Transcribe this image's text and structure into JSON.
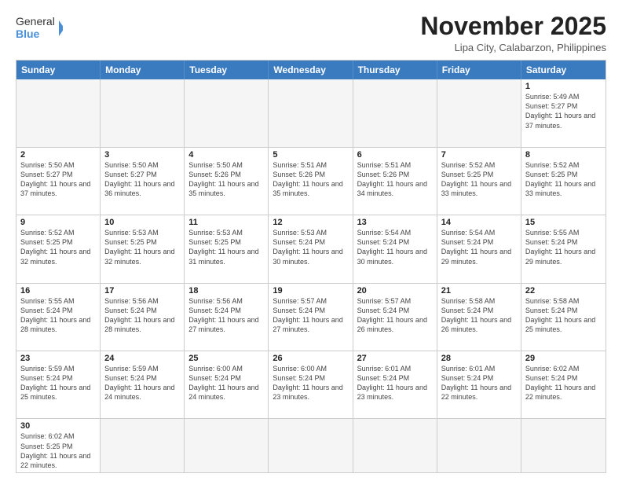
{
  "logo": {
    "text_general": "General",
    "text_blue": "Blue"
  },
  "title": "November 2025",
  "location": "Lipa City, Calabarzon, Philippines",
  "weekdays": [
    "Sunday",
    "Monday",
    "Tuesday",
    "Wednesday",
    "Thursday",
    "Friday",
    "Saturday"
  ],
  "rows": [
    [
      {
        "day": "",
        "info": ""
      },
      {
        "day": "",
        "info": ""
      },
      {
        "day": "",
        "info": ""
      },
      {
        "day": "",
        "info": ""
      },
      {
        "day": "",
        "info": ""
      },
      {
        "day": "",
        "info": ""
      },
      {
        "day": "1",
        "info": "Sunrise: 5:49 AM\nSunset: 5:27 PM\nDaylight: 11 hours and 37 minutes."
      }
    ],
    [
      {
        "day": "2",
        "info": "Sunrise: 5:50 AM\nSunset: 5:27 PM\nDaylight: 11 hours and 37 minutes."
      },
      {
        "day": "3",
        "info": "Sunrise: 5:50 AM\nSunset: 5:27 PM\nDaylight: 11 hours and 36 minutes."
      },
      {
        "day": "4",
        "info": "Sunrise: 5:50 AM\nSunset: 5:26 PM\nDaylight: 11 hours and 35 minutes."
      },
      {
        "day": "5",
        "info": "Sunrise: 5:51 AM\nSunset: 5:26 PM\nDaylight: 11 hours and 35 minutes."
      },
      {
        "day": "6",
        "info": "Sunrise: 5:51 AM\nSunset: 5:26 PM\nDaylight: 11 hours and 34 minutes."
      },
      {
        "day": "7",
        "info": "Sunrise: 5:52 AM\nSunset: 5:25 PM\nDaylight: 11 hours and 33 minutes."
      },
      {
        "day": "8",
        "info": "Sunrise: 5:52 AM\nSunset: 5:25 PM\nDaylight: 11 hours and 33 minutes."
      }
    ],
    [
      {
        "day": "9",
        "info": "Sunrise: 5:52 AM\nSunset: 5:25 PM\nDaylight: 11 hours and 32 minutes."
      },
      {
        "day": "10",
        "info": "Sunrise: 5:53 AM\nSunset: 5:25 PM\nDaylight: 11 hours and 32 minutes."
      },
      {
        "day": "11",
        "info": "Sunrise: 5:53 AM\nSunset: 5:25 PM\nDaylight: 11 hours and 31 minutes."
      },
      {
        "day": "12",
        "info": "Sunrise: 5:53 AM\nSunset: 5:24 PM\nDaylight: 11 hours and 30 minutes."
      },
      {
        "day": "13",
        "info": "Sunrise: 5:54 AM\nSunset: 5:24 PM\nDaylight: 11 hours and 30 minutes."
      },
      {
        "day": "14",
        "info": "Sunrise: 5:54 AM\nSunset: 5:24 PM\nDaylight: 11 hours and 29 minutes."
      },
      {
        "day": "15",
        "info": "Sunrise: 5:55 AM\nSunset: 5:24 PM\nDaylight: 11 hours and 29 minutes."
      }
    ],
    [
      {
        "day": "16",
        "info": "Sunrise: 5:55 AM\nSunset: 5:24 PM\nDaylight: 11 hours and 28 minutes."
      },
      {
        "day": "17",
        "info": "Sunrise: 5:56 AM\nSunset: 5:24 PM\nDaylight: 11 hours and 28 minutes."
      },
      {
        "day": "18",
        "info": "Sunrise: 5:56 AM\nSunset: 5:24 PM\nDaylight: 11 hours and 27 minutes."
      },
      {
        "day": "19",
        "info": "Sunrise: 5:57 AM\nSunset: 5:24 PM\nDaylight: 11 hours and 27 minutes."
      },
      {
        "day": "20",
        "info": "Sunrise: 5:57 AM\nSunset: 5:24 PM\nDaylight: 11 hours and 26 minutes."
      },
      {
        "day": "21",
        "info": "Sunrise: 5:58 AM\nSunset: 5:24 PM\nDaylight: 11 hours and 26 minutes."
      },
      {
        "day": "22",
        "info": "Sunrise: 5:58 AM\nSunset: 5:24 PM\nDaylight: 11 hours and 25 minutes."
      }
    ],
    [
      {
        "day": "23",
        "info": "Sunrise: 5:59 AM\nSunset: 5:24 PM\nDaylight: 11 hours and 25 minutes."
      },
      {
        "day": "24",
        "info": "Sunrise: 5:59 AM\nSunset: 5:24 PM\nDaylight: 11 hours and 24 minutes."
      },
      {
        "day": "25",
        "info": "Sunrise: 6:00 AM\nSunset: 5:24 PM\nDaylight: 11 hours and 24 minutes."
      },
      {
        "day": "26",
        "info": "Sunrise: 6:00 AM\nSunset: 5:24 PM\nDaylight: 11 hours and 23 minutes."
      },
      {
        "day": "27",
        "info": "Sunrise: 6:01 AM\nSunset: 5:24 PM\nDaylight: 11 hours and 23 minutes."
      },
      {
        "day": "28",
        "info": "Sunrise: 6:01 AM\nSunset: 5:24 PM\nDaylight: 11 hours and 22 minutes."
      },
      {
        "day": "29",
        "info": "Sunrise: 6:02 AM\nSunset: 5:24 PM\nDaylight: 11 hours and 22 minutes."
      }
    ],
    [
      {
        "day": "30",
        "info": "Sunrise: 6:02 AM\nSunset: 5:25 PM\nDaylight: 11 hours and 22 minutes."
      },
      {
        "day": "",
        "info": ""
      },
      {
        "day": "",
        "info": ""
      },
      {
        "day": "",
        "info": ""
      },
      {
        "day": "",
        "info": ""
      },
      {
        "day": "",
        "info": ""
      },
      {
        "day": "",
        "info": ""
      }
    ]
  ]
}
